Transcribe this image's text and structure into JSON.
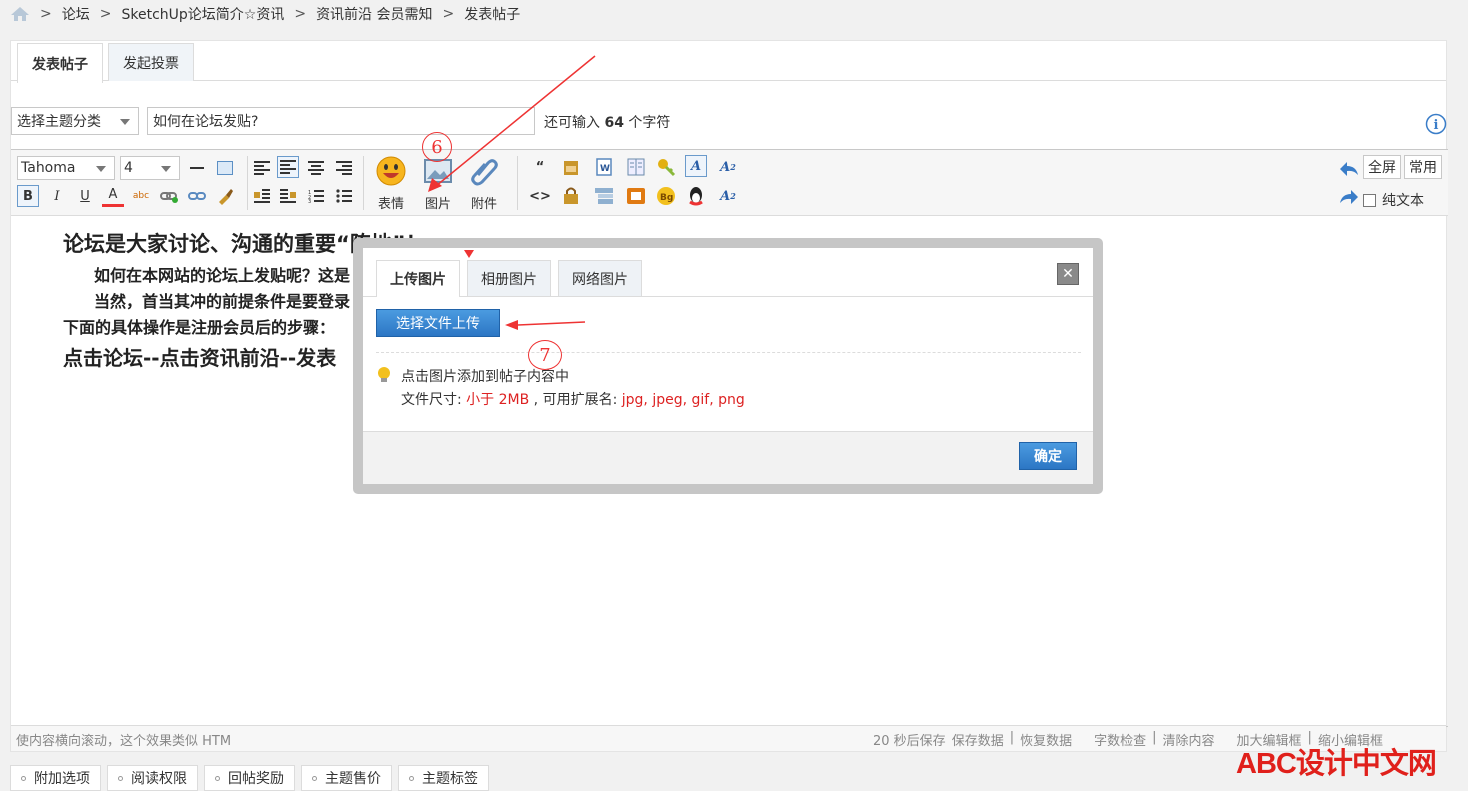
{
  "breadcrumb": [
    "论坛",
    "SketchUp论坛简介☆资讯",
    "资讯前沿 会员需知",
    "发表帖子"
  ],
  "tabs": {
    "post": "发表帖子",
    "poll": "发起投票"
  },
  "subject": {
    "category": "选择主题分类",
    "title": "如何在论坛发贴?",
    "remaining_prefix": "还可输入",
    "remaining_count": "64",
    "remaining_suffix": "个字符"
  },
  "toolbar": {
    "font": "Tahoma",
    "size": "4",
    "emoji": "表情",
    "image": "图片",
    "attachment": "附件",
    "fullscreen": "全屏",
    "common": "常用",
    "plaintext": "纯文本"
  },
  "content": {
    "line1": "论坛是大家讨论、沟通的重要“阵地”！",
    "line2": "如何在本网站的论坛上发贴呢？这是",
    "line3": "当然，首当其冲的前提条件是要登录",
    "line4": "下面的具体操作是注册会员后的步骤：",
    "line5": "点击论坛--点击资讯前沿--发表"
  },
  "status": {
    "left": "使内容横向滚动，这个效果类似 HTM",
    "autosave": "20 秒后保存",
    "save": "保存数据",
    "restore": "恢复数据",
    "check": "字数检查",
    "clear": "清除内容",
    "enlarge": "加大编辑框",
    "shrink": "缩小编辑框"
  },
  "bottom_tabs": [
    "附加选项",
    "阅读权限",
    "回帖奖励",
    "主题售价",
    "主题标签"
  ],
  "dialog": {
    "tabs": [
      "上传图片",
      "相册图片",
      "网络图片"
    ],
    "upload_button": "选择文件上传",
    "hint": "点击图片添加到帖子内容中",
    "size_label": "文件尺寸:",
    "size_value": "小于 2MB",
    "ext_label": ", 可用扩展名:",
    "ext_value": "jpg, jpeg, gif, png",
    "confirm": "确定"
  },
  "annotations": {
    "step6": "6",
    "step7": "7"
  },
  "watermark": "ABC设计中文网",
  "colors": {
    "accent_blue": "#2c76c4",
    "red": "#e33",
    "link_red": "#d22"
  }
}
